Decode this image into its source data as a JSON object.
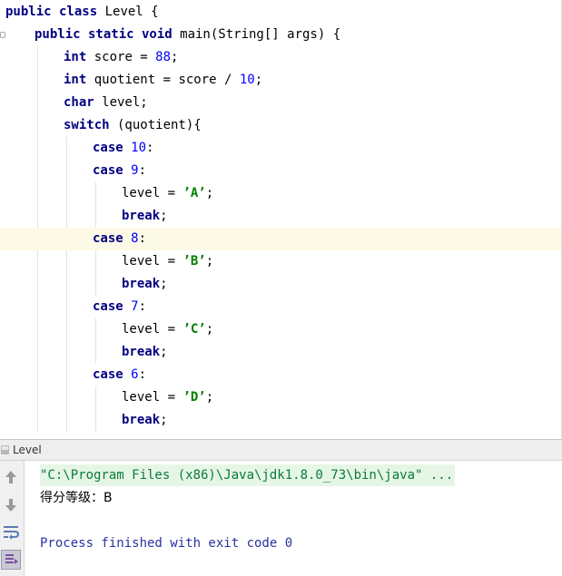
{
  "editor": {
    "lines": [
      [
        {
          "t": "public class",
          "s": "kw"
        },
        {
          "t": " Level {",
          "s": ""
        }
      ],
      [
        {
          "t": "public static void",
          "s": "kw"
        },
        {
          "t": " main(String[] args) {",
          "s": ""
        }
      ],
      [
        {
          "t": "int",
          "s": "kw"
        },
        {
          "t": " score = ",
          "s": ""
        },
        {
          "t": "88",
          "s": "num"
        },
        {
          "t": ";",
          "s": ""
        }
      ],
      [
        {
          "t": "int",
          "s": "kw"
        },
        {
          "t": " quotient = score / ",
          "s": ""
        },
        {
          "t": "10",
          "s": "num"
        },
        {
          "t": ";",
          "s": ""
        }
      ],
      [
        {
          "t": "char",
          "s": "kw"
        },
        {
          "t": " level;",
          "s": ""
        }
      ],
      [
        {
          "t": "switch",
          "s": "kw"
        },
        {
          "t": " (quotient){",
          "s": ""
        }
      ],
      [
        {
          "t": "case",
          "s": "kw"
        },
        {
          "t": " ",
          "s": ""
        },
        {
          "t": "10",
          "s": "num"
        },
        {
          "t": ":",
          "s": ""
        }
      ],
      [
        {
          "t": "case",
          "s": "kw"
        },
        {
          "t": " ",
          "s": ""
        },
        {
          "t": "9",
          "s": "num"
        },
        {
          "t": ":",
          "s": ""
        }
      ],
      [
        {
          "t": "level = ",
          "s": ""
        },
        {
          "t": "’A’",
          "s": "str"
        },
        {
          "t": ";",
          "s": ""
        }
      ],
      [
        {
          "t": "break",
          "s": "kw"
        },
        {
          "t": ";",
          "s": ""
        }
      ],
      [
        {
          "t": "case",
          "s": "kw"
        },
        {
          "t": " ",
          "s": ""
        },
        {
          "t": "8",
          "s": "num"
        },
        {
          "t": ":",
          "s": ""
        }
      ],
      [
        {
          "t": "level = ",
          "s": ""
        },
        {
          "t": "’B’",
          "s": "str"
        },
        {
          "t": ";",
          "s": ""
        }
      ],
      [
        {
          "t": "break",
          "s": "kw"
        },
        {
          "t": ";",
          "s": ""
        }
      ],
      [
        {
          "t": "case",
          "s": "kw"
        },
        {
          "t": " ",
          "s": ""
        },
        {
          "t": "7",
          "s": "num"
        },
        {
          "t": ":",
          "s": ""
        }
      ],
      [
        {
          "t": "level = ",
          "s": ""
        },
        {
          "t": "’C’",
          "s": "str"
        },
        {
          "t": ";",
          "s": ""
        }
      ],
      [
        {
          "t": "break",
          "s": "kw"
        },
        {
          "t": ";",
          "s": ""
        }
      ],
      [
        {
          "t": "case",
          "s": "kw"
        },
        {
          "t": " ",
          "s": ""
        },
        {
          "t": "6",
          "s": "num"
        },
        {
          "t": ":",
          "s": ""
        }
      ],
      [
        {
          "t": "level = ",
          "s": ""
        },
        {
          "t": "’D’",
          "s": "str"
        },
        {
          "t": ";",
          "s": ""
        }
      ],
      [
        {
          "t": "break",
          "s": "kw"
        },
        {
          "t": ";",
          "s": ""
        }
      ]
    ],
    "current_line": 10
  },
  "run_panel": {
    "tab_title": "Level",
    "tab_icon": "run-config-icon",
    "toolbar": [
      {
        "icon": "arrow-up-icon",
        "pressed": false
      },
      {
        "icon": "arrow-down-icon",
        "pressed": false
      },
      {
        "icon": "soft-wrap-icon",
        "pressed": false
      },
      {
        "icon": "scroll-to-end-icon",
        "pressed": true
      }
    ],
    "console": {
      "command": "\"C:\\Program Files (x86)\\Java\\jdk1.8.0_73\\bin\\java\" ...",
      "output": "得分等级：B",
      "status": "Process finished with exit code 0"
    }
  },
  "colors": {
    "keyword": "#000080",
    "number": "#0000ff",
    "string": "#008000",
    "current_line": "#fcf9e6",
    "console_command": "#0a7a3a",
    "console_status": "#2a32a0"
  }
}
